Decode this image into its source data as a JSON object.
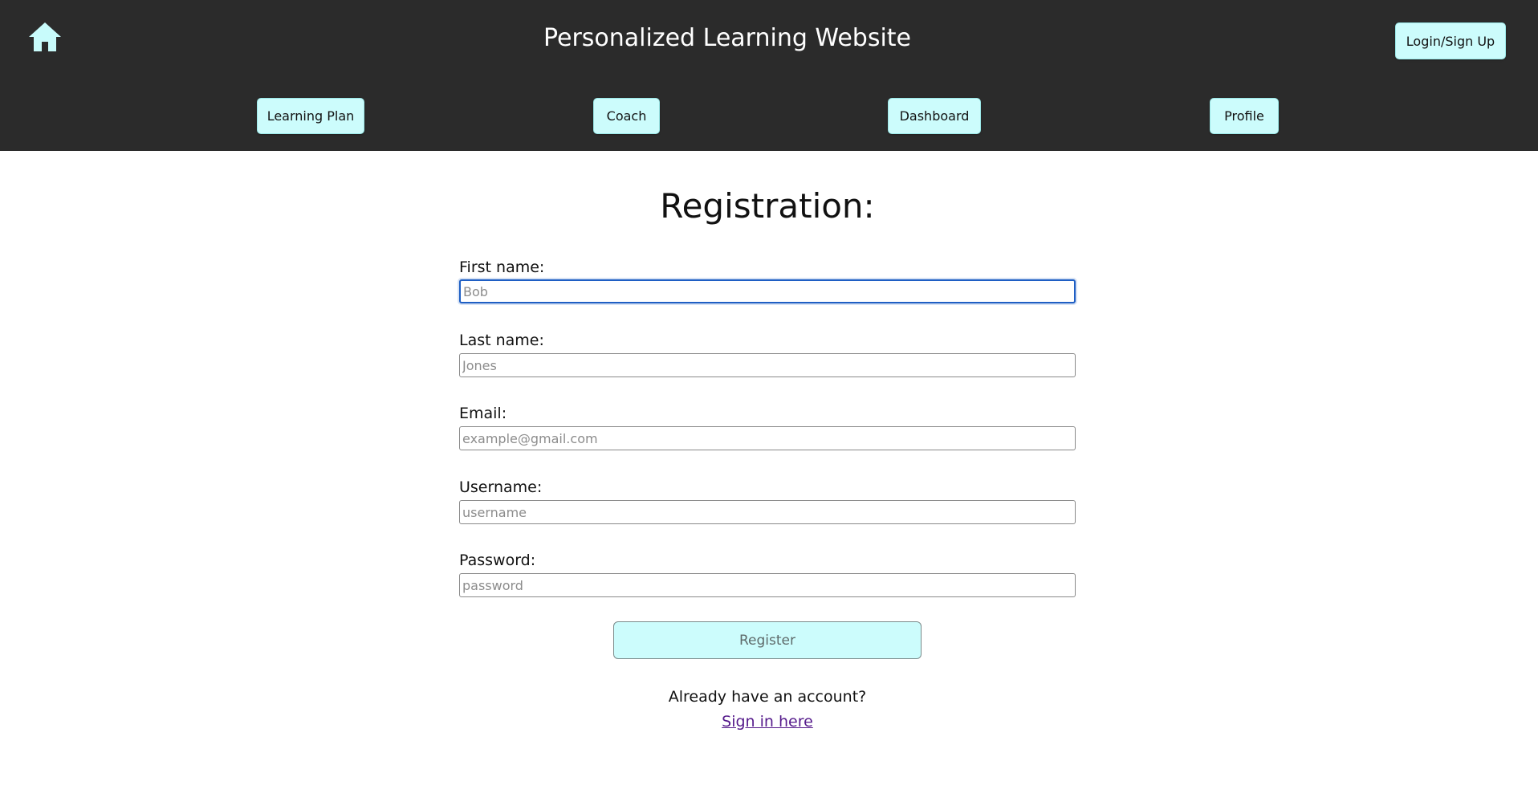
{
  "header": {
    "home_icon": "home-icon",
    "title": "Personalized Learning Website",
    "login_label": "Login/Sign Up",
    "nav": [
      {
        "label": "Learning Plan"
      },
      {
        "label": "Coach"
      },
      {
        "label": "Dashboard"
      },
      {
        "label": "Profile"
      }
    ]
  },
  "form": {
    "heading": "Registration:",
    "fields": [
      {
        "label": "First name:",
        "placeholder": "Bob",
        "value": ""
      },
      {
        "label": "Last name:",
        "placeholder": "Jones",
        "value": ""
      },
      {
        "label": "Email:",
        "placeholder": "example@gmail.com",
        "value": ""
      },
      {
        "label": "Username:",
        "placeholder": "username",
        "value": ""
      },
      {
        "label": "Password:",
        "placeholder": "password",
        "value": ""
      }
    ],
    "register_label": "Register",
    "already_text": "Already have an account?",
    "signin_link": "Sign in here"
  },
  "colors": {
    "header_bg": "#2b2b2b",
    "button_bg": "#ccfcfc",
    "home_icon": "#c8fbfb",
    "link": "#551a8b",
    "focus_border": "#1f5fc4"
  }
}
